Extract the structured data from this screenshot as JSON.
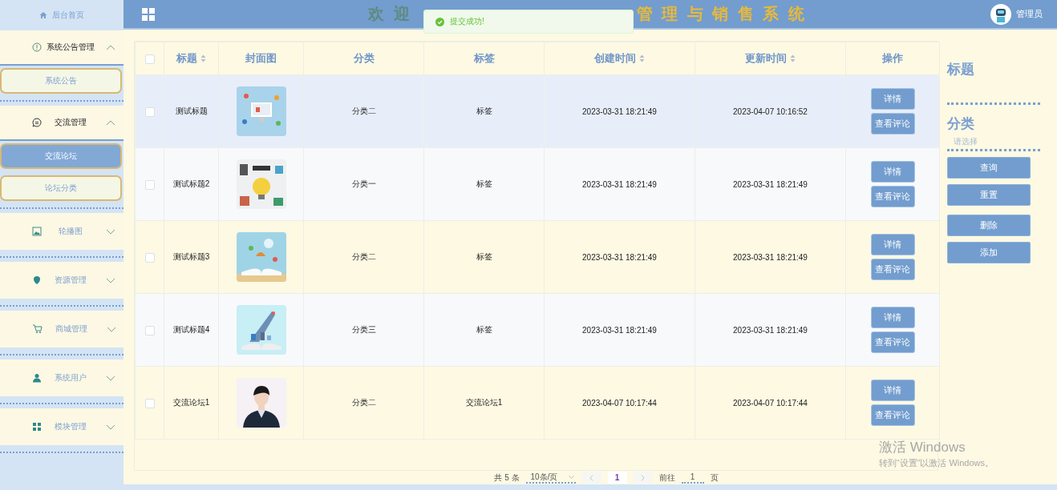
{
  "header": {
    "title_visible_start": "欢 迎",
    "title_visible_end": "管 理 与 销 售 系 统",
    "user": "管理员"
  },
  "toast": {
    "message": "提交成功!"
  },
  "sidebar": {
    "home": "后台首页",
    "groups": [
      {
        "label": "系统公告管理",
        "expanded": true,
        "children": [
          {
            "label": "系统公告",
            "selected": false
          }
        ]
      },
      {
        "label": "交流管理",
        "expanded": true,
        "children": [
          {
            "label": "交流论坛",
            "selected": true
          },
          {
            "label": "论坛分类",
            "selected": false
          }
        ]
      },
      {
        "label": "轮播图",
        "expanded": false
      },
      {
        "label": "资源管理",
        "expanded": false
      },
      {
        "label": "商城管理",
        "expanded": false
      },
      {
        "label": "系统用户",
        "expanded": false
      },
      {
        "label": "模块管理",
        "expanded": false
      }
    ]
  },
  "table": {
    "columns": [
      {
        "label": "标题",
        "sortable": true
      },
      {
        "label": "封面图",
        "sortable": false
      },
      {
        "label": "分类",
        "sortable": false
      },
      {
        "label": "标签",
        "sortable": false
      },
      {
        "label": "创建时间",
        "sortable": true
      },
      {
        "label": "更新时间",
        "sortable": true
      },
      {
        "label": "操作",
        "sortable": false
      }
    ],
    "header_checked": false,
    "rows": [
      {
        "checked": false,
        "hovered": true,
        "title": "测试标题",
        "category": "分类二",
        "tag": "标签",
        "created": "2023-03-31 18:21:49",
        "updated": "2023-04-07 10:16:52",
        "actions": [
          "详情",
          "查看评论"
        ]
      },
      {
        "checked": false,
        "hovered": false,
        "title": "测试标题2",
        "category": "分类一",
        "tag": "标签",
        "created": "2023-03-31 18:21:49",
        "updated": "2023-03-31 18:21:49",
        "actions": [
          "详情",
          "查看评论"
        ]
      },
      {
        "checked": false,
        "hovered": false,
        "title": "测试标题3",
        "category": "分类二",
        "tag": "标签",
        "created": "2023-03-31 18:21:49",
        "updated": "2023-03-31 18:21:49",
        "actions": [
          "详情",
          "查看评论"
        ]
      },
      {
        "checked": false,
        "hovered": false,
        "title": "测试标题4",
        "category": "分类三",
        "tag": "标签",
        "created": "2023-03-31 18:21:49",
        "updated": "2023-03-31 18:21:49",
        "actions": [
          "详情",
          "查看评论"
        ]
      },
      {
        "checked": false,
        "hovered": false,
        "title": "交流论坛1",
        "category": "分类二",
        "tag": "交流论坛1",
        "created": "2023-04-07 10:17:44",
        "updated": "2023-04-07 10:17:44",
        "actions": [
          "详情",
          "查看评论"
        ]
      }
    ]
  },
  "search_panel": {
    "title_label": "标题",
    "category_label": "分类",
    "category_placeholder": "请选择",
    "buttons": [
      "查询",
      "重置",
      "删除",
      "添加"
    ]
  },
  "pagination": {
    "total": "共 5 条",
    "page_size": "10条/页",
    "pages": [
      {
        "label": "1",
        "selected": true
      }
    ],
    "goto_label": "前往",
    "goto_value": "1",
    "goto_suffix": "页"
  },
  "os_notice": {
    "title": "激活 Windows",
    "subtitle": "转到“设置”以激活 Windows。"
  }
}
